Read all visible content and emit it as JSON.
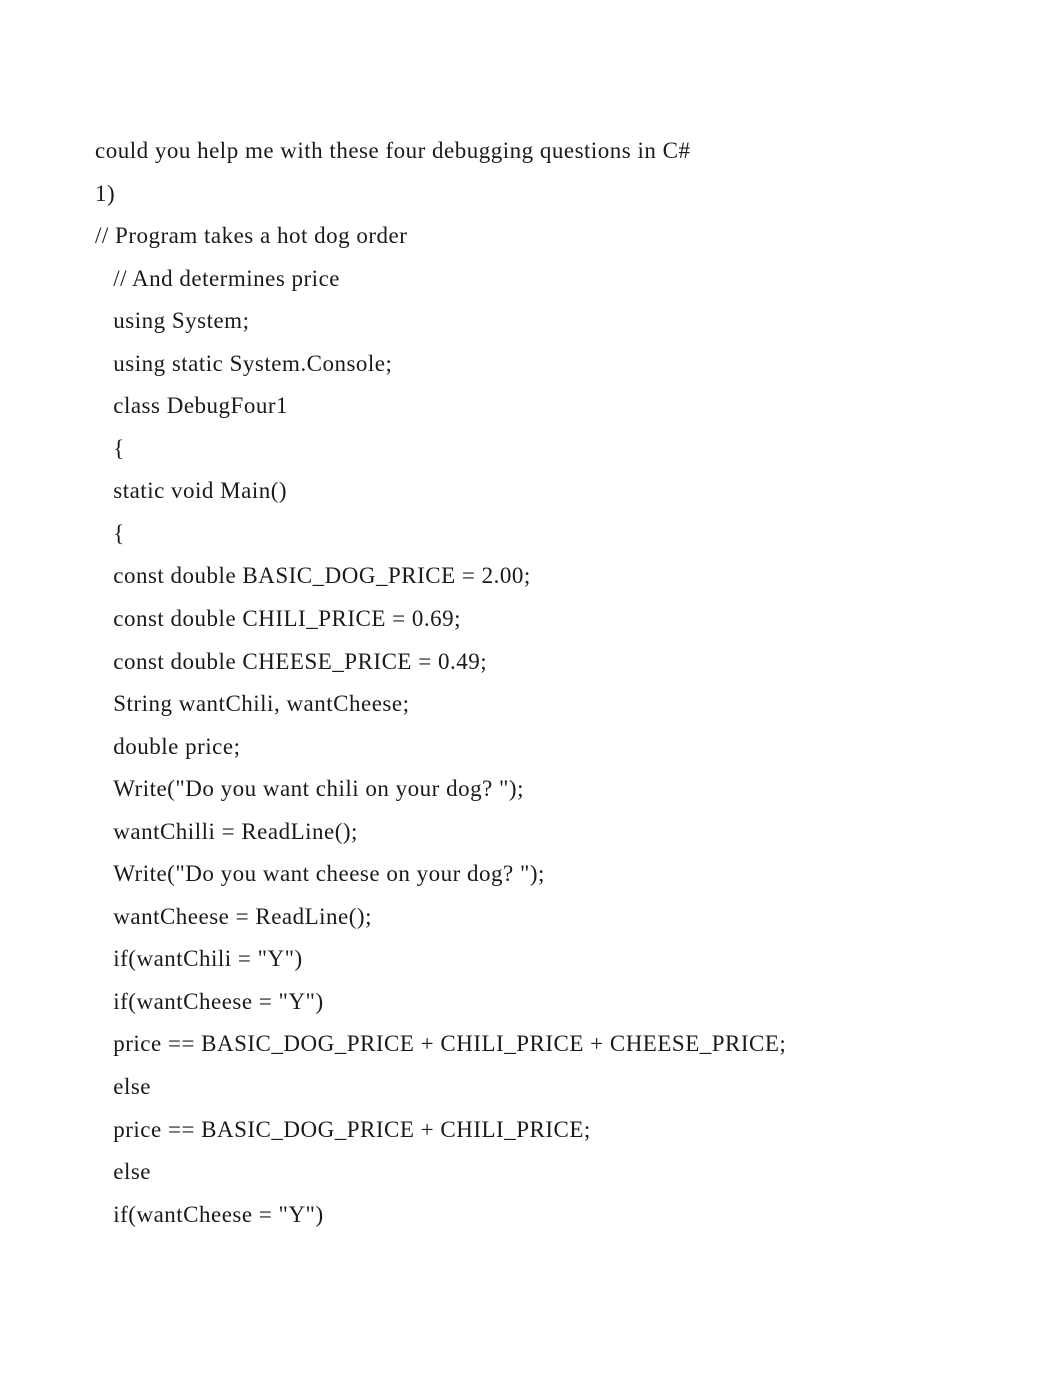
{
  "lines": [
    {
      "text": "could you help me with these four debugging questions in C#",
      "indent": false
    },
    {
      "text": "1)",
      "indent": false
    },
    {
      "text": "// Program takes a hot dog order",
      "indent": false
    },
    {
      "text": " // And determines price",
      "indent": true
    },
    {
      "text": " using System;",
      "indent": true
    },
    {
      "text": " using static System.Console;",
      "indent": true
    },
    {
      "text": " class DebugFour1",
      "indent": true
    },
    {
      "text": " {",
      "indent": true
    },
    {
      "text": " static void Main()",
      "indent": true
    },
    {
      "text": " {",
      "indent": true
    },
    {
      "text": " const double BASIC_DOG_PRICE = 2.00;",
      "indent": true
    },
    {
      "text": " const double CHILI_PRICE = 0.69;",
      "indent": true
    },
    {
      "text": " const double CHEESE_PRICE = 0.49;",
      "indent": true
    },
    {
      "text": " String wantChili, wantCheese;",
      "indent": true
    },
    {
      "text": " double price;",
      "indent": true
    },
    {
      "text": " Write(\"Do you want chili on your dog? \");",
      "indent": true
    },
    {
      "text": " wantChilli = ReadLine();",
      "indent": true
    },
    {
      "text": " Write(\"Do you want cheese on your dog? \");",
      "indent": true
    },
    {
      "text": " wantCheese = ReadLine();",
      "indent": true
    },
    {
      "text": " if(wantChili = \"Y\")",
      "indent": true
    },
    {
      "text": " if(wantCheese = \"Y\")",
      "indent": true
    },
    {
      "text": " price == BASIC_DOG_PRICE + CHILI_PRICE + CHEESE_PRICE;",
      "indent": true
    },
    {
      "text": " else",
      "indent": true
    },
    {
      "text": " price == BASIC_DOG_PRICE + CHILI_PRICE;",
      "indent": true
    },
    {
      "text": " else",
      "indent": true
    },
    {
      "text": " if(wantCheese = \"Y\")",
      "indent": true
    }
  ]
}
